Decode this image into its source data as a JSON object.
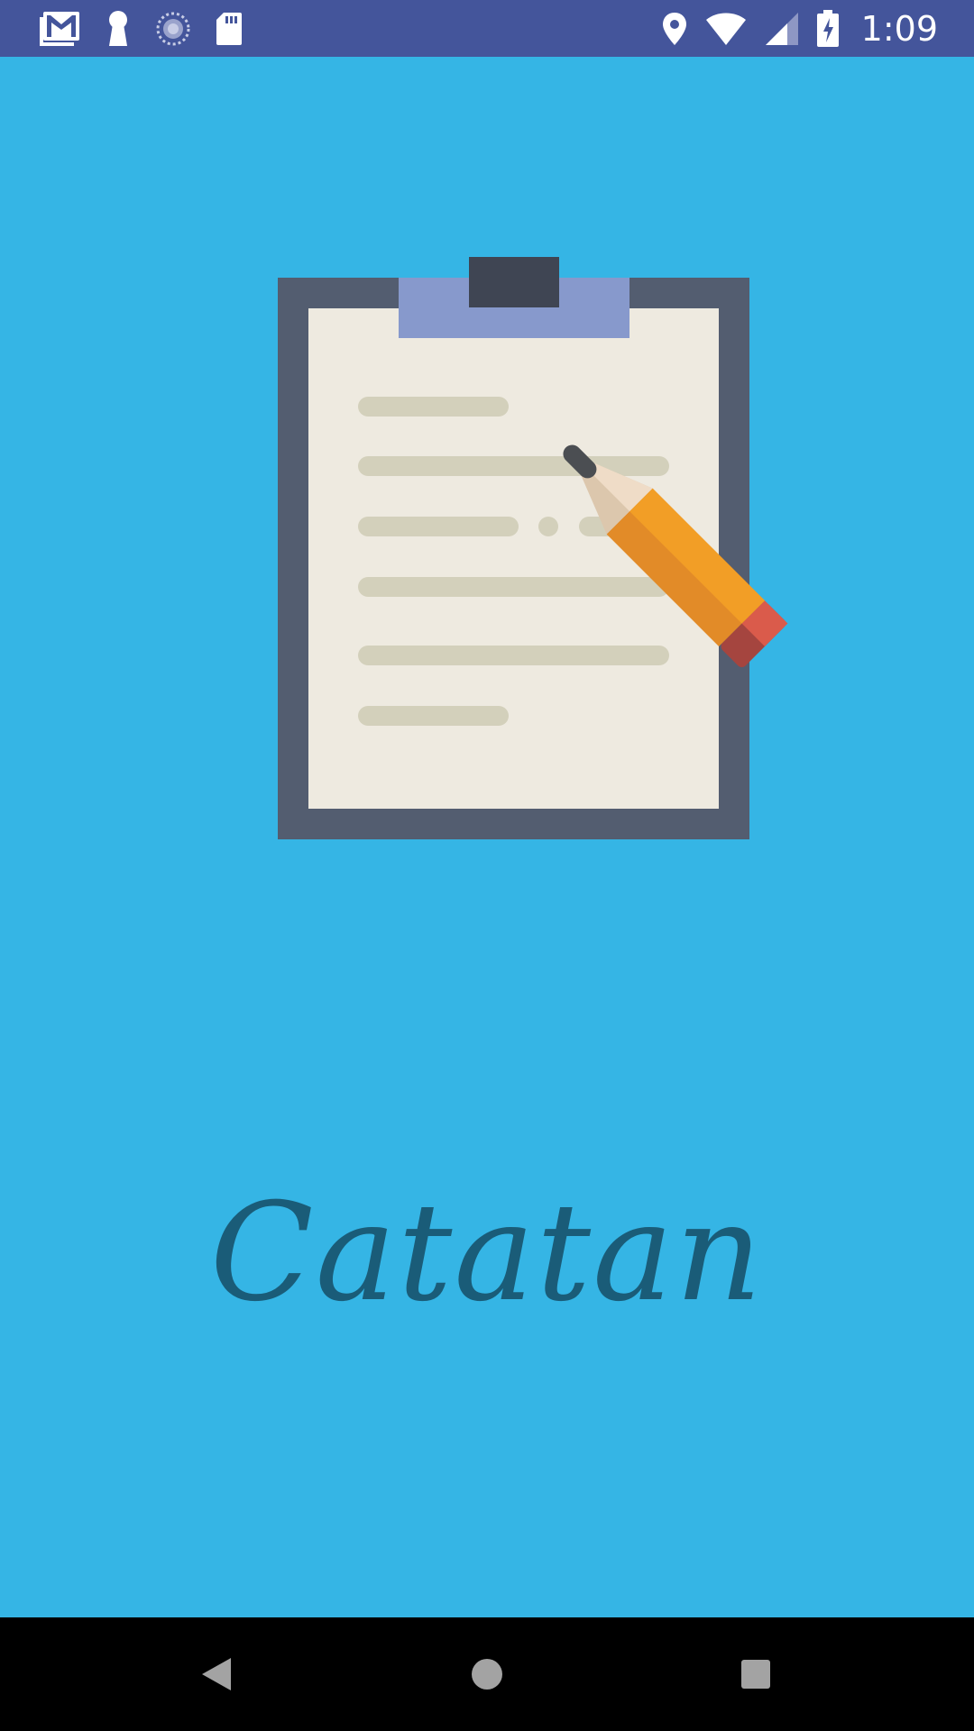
{
  "status_bar": {
    "time": "1:09",
    "left_icons": [
      "gmail-icon",
      "keyhole-icon",
      "sync-icon",
      "sd-card-icon"
    ],
    "right_icons": [
      "location-icon",
      "wifi-icon",
      "signal-icon",
      "battery-charging-icon"
    ],
    "background_color": "#44559b"
  },
  "splash": {
    "app_name": "Catatan",
    "logo_icon": "clipboard-pencil-icon",
    "background_color": "#35b5e5",
    "app_name_color": "#1a5c78"
  },
  "nav_bar": {
    "buttons": [
      "back-icon",
      "home-icon",
      "recents-icon"
    ],
    "background_color": "#000000"
  }
}
